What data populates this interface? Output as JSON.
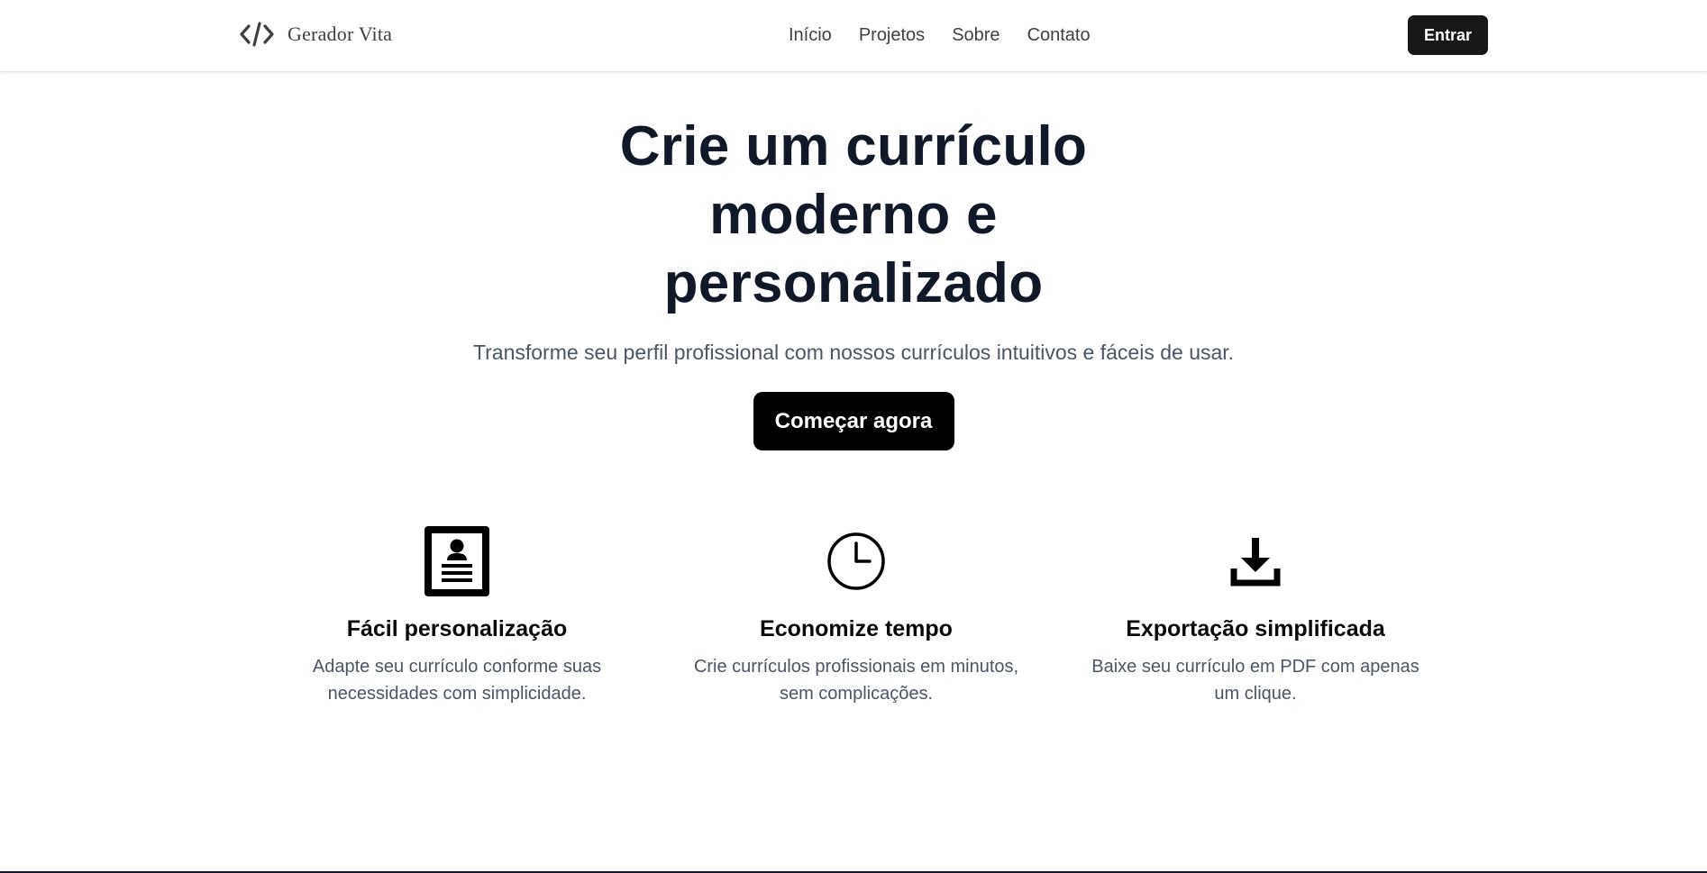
{
  "brand": {
    "name": "Gerador Vita",
    "icon": "code-brackets-icon"
  },
  "nav": {
    "links": [
      "Início",
      "Projetos",
      "Sobre",
      "Contato"
    ],
    "login_label": "Entrar"
  },
  "hero": {
    "title": "Crie um currículo moderno e personalizado",
    "subtitle": "Transforme seu perfil profissional com nossos currículos intuitivos e fáceis de usar.",
    "cta_label": "Começar agora"
  },
  "features": [
    {
      "icon": "profile-card-icon",
      "title": "Fácil personalização",
      "description": "Adapte seu currículo conforme suas necessidades com simplicidade."
    },
    {
      "icon": "clock-icon",
      "title": "Economize tempo",
      "description": "Crie currículos profissionais em minutos, sem complicações."
    },
    {
      "icon": "download-icon",
      "title": "Exportação simplificada",
      "description": "Baixe seu currículo em PDF com apenas um clique."
    }
  ],
  "colors": {
    "primary_button": "#000000",
    "login_button": "#18181b",
    "heading": "#111827",
    "body_text": "#4b5563"
  }
}
